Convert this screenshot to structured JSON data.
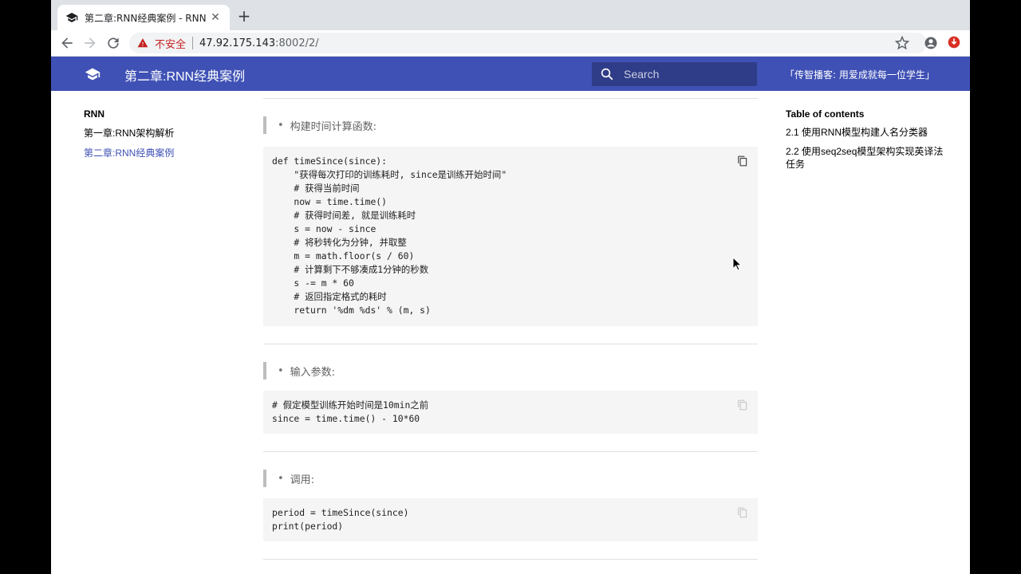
{
  "browser": {
    "tab_title": "第二章:RNN经典案例 - RNN",
    "tab_close": "✕",
    "new_tab": "+",
    "security_label": "不安全",
    "url_host": "47.92.175.143",
    "url_rest": ":8002/2/"
  },
  "header": {
    "site_title": "第二章:RNN经典案例",
    "search_placeholder": "Search",
    "slogan": "「传智播客: 用爱成就每一位学生」",
    "bar_color": "#3f51b5"
  },
  "leftnav": {
    "heading": "RNN",
    "items": [
      {
        "label": "第一章:RNN架构解析",
        "active": false
      },
      {
        "label": "第二章:RNN经典案例",
        "active": true
      }
    ]
  },
  "toc": {
    "heading": "Table of contents",
    "items": [
      {
        "label": "2.1 使用RNN模型构建人名分类器"
      },
      {
        "label": "2.2 使用seq2seq模型架构实现英译法任务"
      }
    ]
  },
  "content": {
    "sections": [
      {
        "title": "构建时间计算函数:",
        "code": [
          "def timeSince(since):",
          "    \"获得每次打印的训练耗时, since是训练开始时间\"",
          "    # 获得当前时间",
          "    now = time.time()",
          "    # 获得时间差, 就是训练耗时",
          "    s = now - since",
          "    # 将秒转化为分钟, 并取整",
          "    m = math.floor(s / 60)",
          "    # 计算剩下不够凑成1分钟的秒数",
          "    s -= m * 60",
          "    # 返回指定格式的耗时",
          "    return '%dm %ds' % (m, s)"
        ]
      },
      {
        "title": "输入参数:",
        "code": [
          "# 假定模型训练开始时间是10min之前",
          "since = time.time() - 10*60"
        ]
      },
      {
        "title": "调用:",
        "code": [
          "period = timeSince(since)",
          "print(period)"
        ]
      }
    ]
  }
}
